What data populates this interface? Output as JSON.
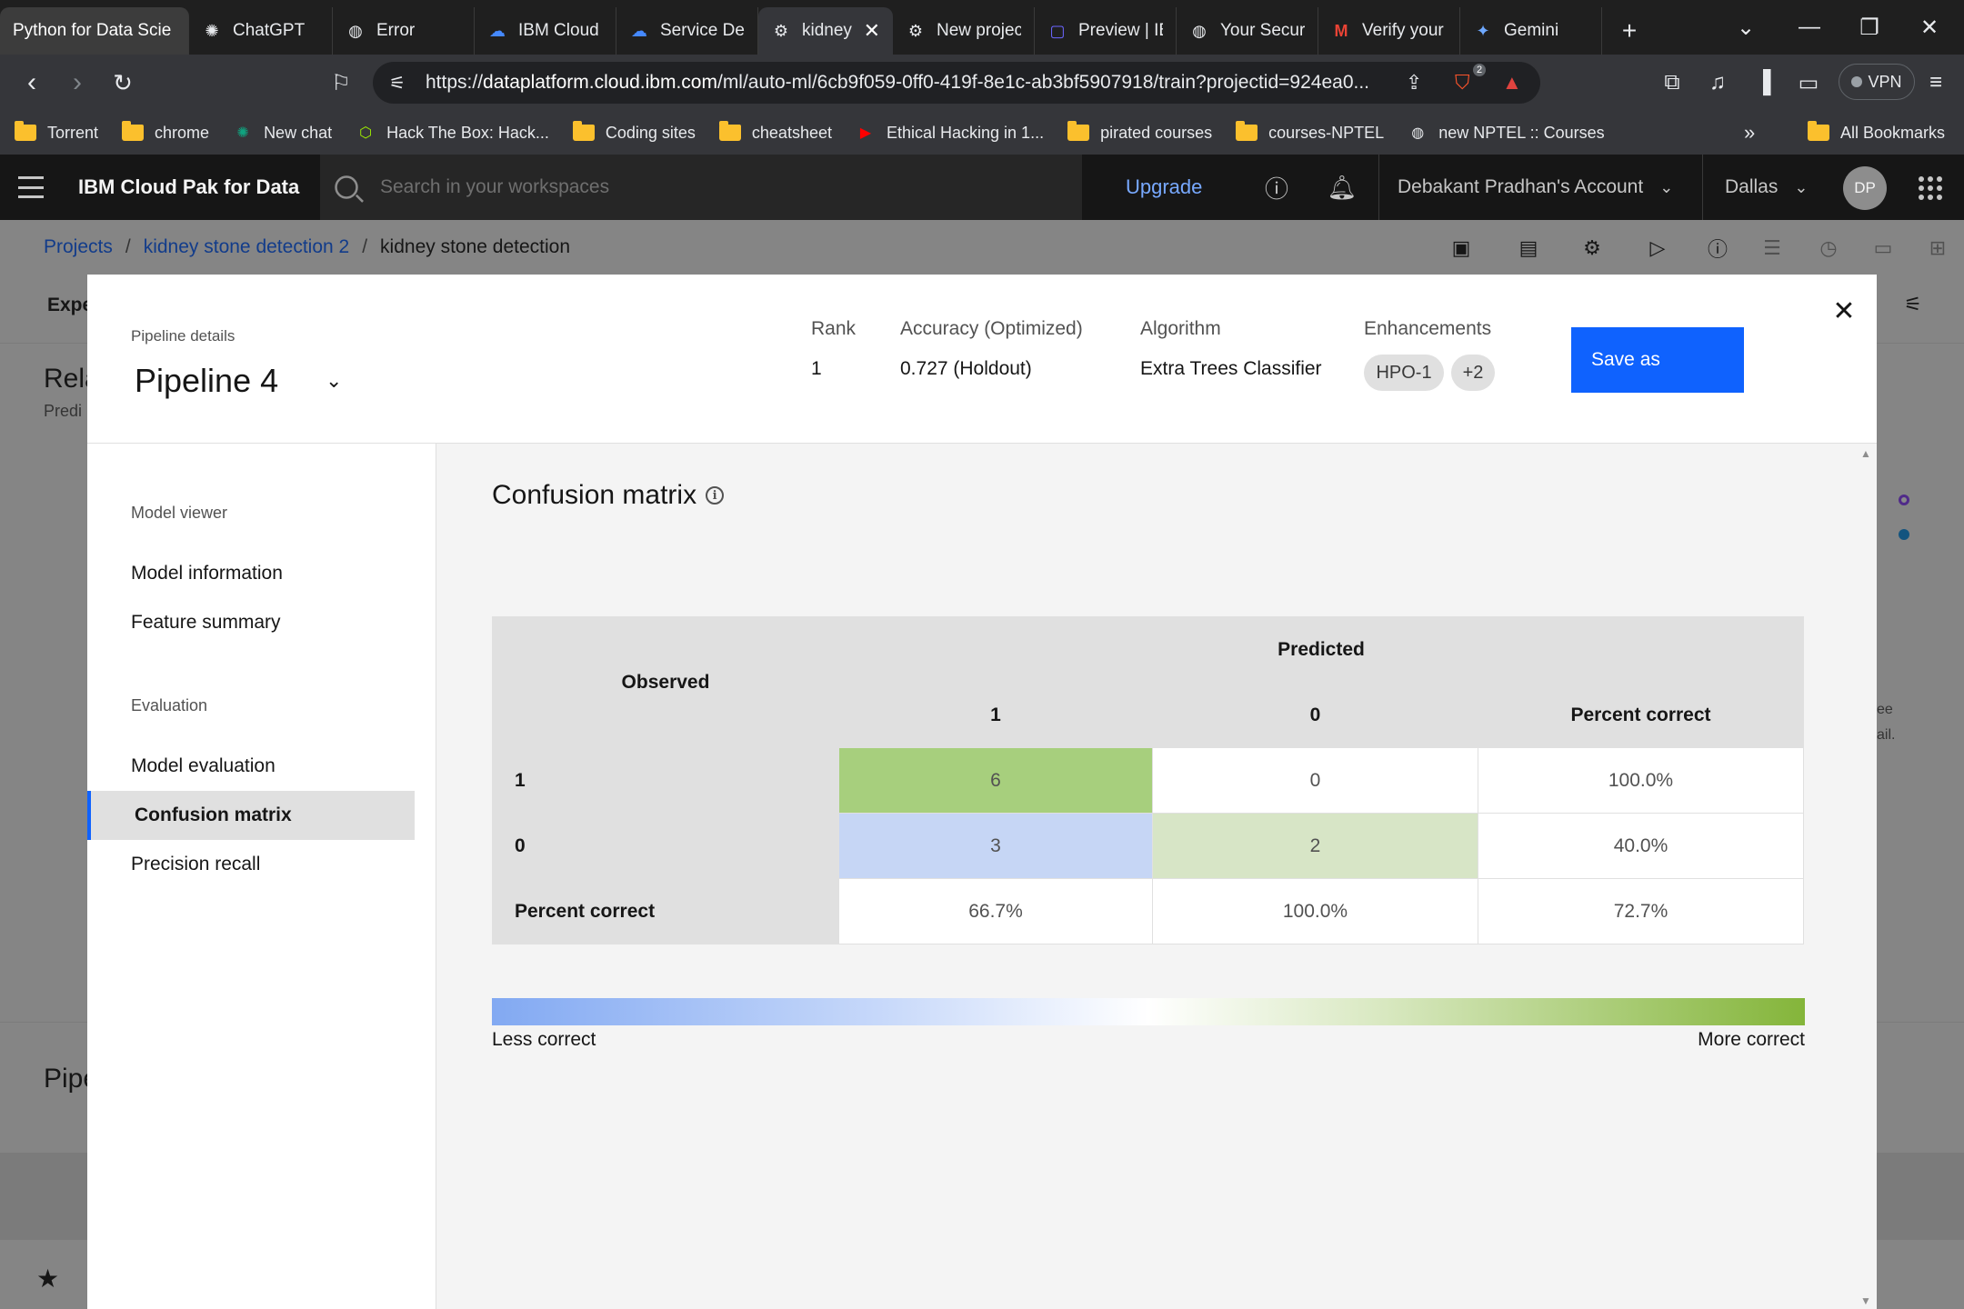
{
  "browser": {
    "tabs": [
      {
        "label": "Python for Data Scie",
        "icon": "page-icon"
      },
      {
        "label": "ChatGPT",
        "icon": "chatgpt-icon"
      },
      {
        "label": "Error",
        "icon": "globe-icon"
      },
      {
        "label": "IBM Cloud",
        "icon": "ibm-cloud-icon"
      },
      {
        "label": "Service Det",
        "icon": "ibm-cloud-icon"
      },
      {
        "label": "kidney",
        "icon": "pipeline-icon"
      },
      {
        "label": "New projec",
        "icon": "pipeline-icon"
      },
      {
        "label": "Preview | IB",
        "icon": "preview-icon"
      },
      {
        "label": "Your Secur",
        "icon": "globe-icon"
      },
      {
        "label": "Verify your",
        "icon": "gmail-icon"
      },
      {
        "label": "Gemini",
        "icon": "gemini-icon"
      }
    ],
    "url_prefix": "https://",
    "url_host": "dataplatform.cloud.ibm.com",
    "url_path": "/ml/auto-ml/6cb9f059-0ff0-419f-8e1c-ab3bf5907918/train?projectid=924ea0...",
    "brave_badge": "2",
    "vpn_label": "VPN",
    "bookmarks": [
      {
        "label": "Torrent",
        "type": "folder"
      },
      {
        "label": "chrome",
        "type": "folder"
      },
      {
        "label": "New chat",
        "type": "chatgpt"
      },
      {
        "label": "Hack The Box: Hack...",
        "type": "htb"
      },
      {
        "label": "Coding sites",
        "type": "folder"
      },
      {
        "label": "cheatsheet",
        "type": "folder"
      },
      {
        "label": "Ethical Hacking in 1...",
        "type": "youtube"
      },
      {
        "label": "pirated courses",
        "type": "folder"
      },
      {
        "label": "courses-NPTEL",
        "type": "folder"
      },
      {
        "label": "new NPTEL :: Courses",
        "type": "globe"
      }
    ],
    "all_bookmarks": "All Bookmarks"
  },
  "app": {
    "brand": "IBM Cloud Pak for Data",
    "search_placeholder": "Search in your workspaces",
    "upgrade": "Upgrade",
    "account": "Debakant Pradhan's Account",
    "region": "Dallas",
    "avatar_initials": "DP"
  },
  "breadcrumb": {
    "projects": "Projects",
    "project": "kidney stone detection 2",
    "current": "kidney stone detection"
  },
  "background": {
    "tab_partial": "Expe",
    "heading_partial": "Rela",
    "sub_partial": "Predi",
    "section_partial": "Pipe",
    "side_text_1": "ee",
    "side_text_2": "ail."
  },
  "modal": {
    "pipeline_label": "Pipeline details",
    "pipeline_name": "Pipeline 4",
    "rank_label": "Rank",
    "rank_value": "1",
    "accuracy_label": "Accuracy  (Optimized)",
    "accuracy_value": "0.727 (Holdout)",
    "algorithm_label": "Algorithm",
    "algorithm_value": "Extra Trees Classifier",
    "enhancements_label": "Enhancements",
    "enhancement_tag": "HPO-1",
    "enhancement_more": "+2",
    "save_as": "Save as"
  },
  "sidebar": {
    "group1": "Model viewer",
    "model_information": "Model information",
    "feature_summary": "Feature summary",
    "group2": "Evaluation",
    "model_evaluation": "Model evaluation",
    "confusion_matrix": "Confusion matrix",
    "precision_recall": "Precision recall"
  },
  "confusion_matrix": {
    "title": "Confusion matrix",
    "observed_header": "Observed",
    "predicted_header": "Predicted",
    "col_1": "1",
    "col_0": "0",
    "col_pc": "Percent correct",
    "rows": [
      {
        "label": "1",
        "pred_1": "6",
        "pred_0": "0",
        "pc": "100.0%"
      },
      {
        "label": "0",
        "pred_1": "3",
        "pred_0": "2",
        "pc": "40.0%"
      },
      {
        "label": "Percent correct",
        "pred_1": "66.7%",
        "pred_0": "100.0%",
        "pc": "72.7%"
      }
    ],
    "legend_less": "Less correct",
    "legend_more": "More correct",
    "colors": {
      "correct_strong": "#a7cf7d",
      "correct_light": "#d7e5c6",
      "incorrect": "#c6d6f5"
    }
  }
}
